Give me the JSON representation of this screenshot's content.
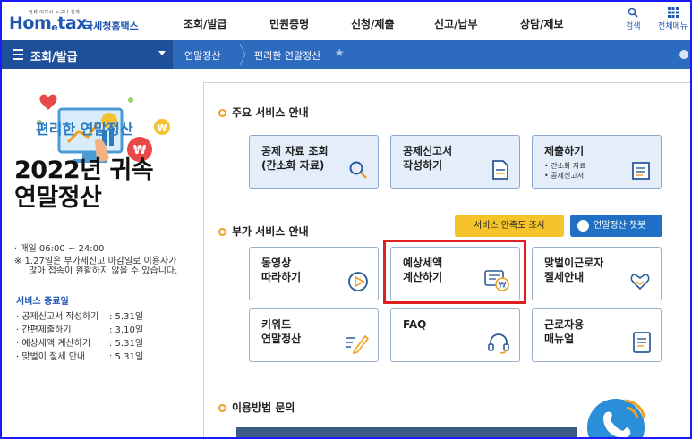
{
  "header": {
    "logo_tagline": "언제 어디서 누구나 쉽게",
    "logo_brand_home": "Hom",
    "logo_brand_e": "e",
    "logo_brand_tax": "tax.",
    "logo_subtitle": "국세청홈택스",
    "nav": [
      "조회/발급",
      "민원증명",
      "신청/제출",
      "신고/납부",
      "상담/제보"
    ],
    "search_label": "검색",
    "menu_label": "전체메뉴"
  },
  "breadcrumb": {
    "menu_label": "조회/발급",
    "level2": "연말정산",
    "level3": "편리한 연말정산"
  },
  "left": {
    "hero_title": "편리한 연말정산",
    "year_title_line1": "2022년 귀속",
    "year_title_line2": "연말정산",
    "hours": "· 매일 06:00 ~ 24:00",
    "notice_line1": "※ 1.27일은 부가세신고 마감일로 이용자가",
    "notice_line2": "많아 접속이 원활하지 않을 수 있습니다.",
    "schedule_title": "서비스 종료일",
    "schedule": [
      {
        "name": "· 공제신고서 작성하기",
        "date": ": 5.31일"
      },
      {
        "name": "· 간편제출하기",
        "date": ": 3.10일"
      },
      {
        "name": "· 예상세액 계산하기",
        "date": ": 5.31일"
      },
      {
        "name": "· 맞벌이 절세 안내",
        "date": ": 5.31일"
      }
    ]
  },
  "main_services": {
    "title": "주요 서비스 안내",
    "cards": [
      {
        "line1": "공제 자료 조회",
        "line2": "(간소화 자료)"
      },
      {
        "line1": "공제신고서",
        "line2": "작성하기"
      },
      {
        "line1": "제출하기",
        "sub1": "• 간소화 자료",
        "sub2": "• 공제신고서"
      }
    ]
  },
  "extra_services": {
    "title": "부가 서비스 안내",
    "survey_button": "서비스 만족도 조사",
    "chatbot_button": "연말정산 챗봇",
    "cards": [
      {
        "line1": "동영상",
        "line2": "따라하기"
      },
      {
        "line1": "예상세액",
        "line2": "계산하기"
      },
      {
        "line1": "맞벌이근로자",
        "line2": "절세안내"
      },
      {
        "line1": "키워드",
        "line2": "연말정산"
      },
      {
        "line1": "FAQ",
        "line2": ""
      },
      {
        "line1": "근로자용",
        "line2": "매뉴얼"
      }
    ]
  },
  "help": {
    "title": "이용방법 문의"
  },
  "colors": {
    "brand_blue": "#1f56b3",
    "nav_bar": "#2d6bbf",
    "highlight_red": "#e02020",
    "survey_yellow": "#f5c32a"
  }
}
